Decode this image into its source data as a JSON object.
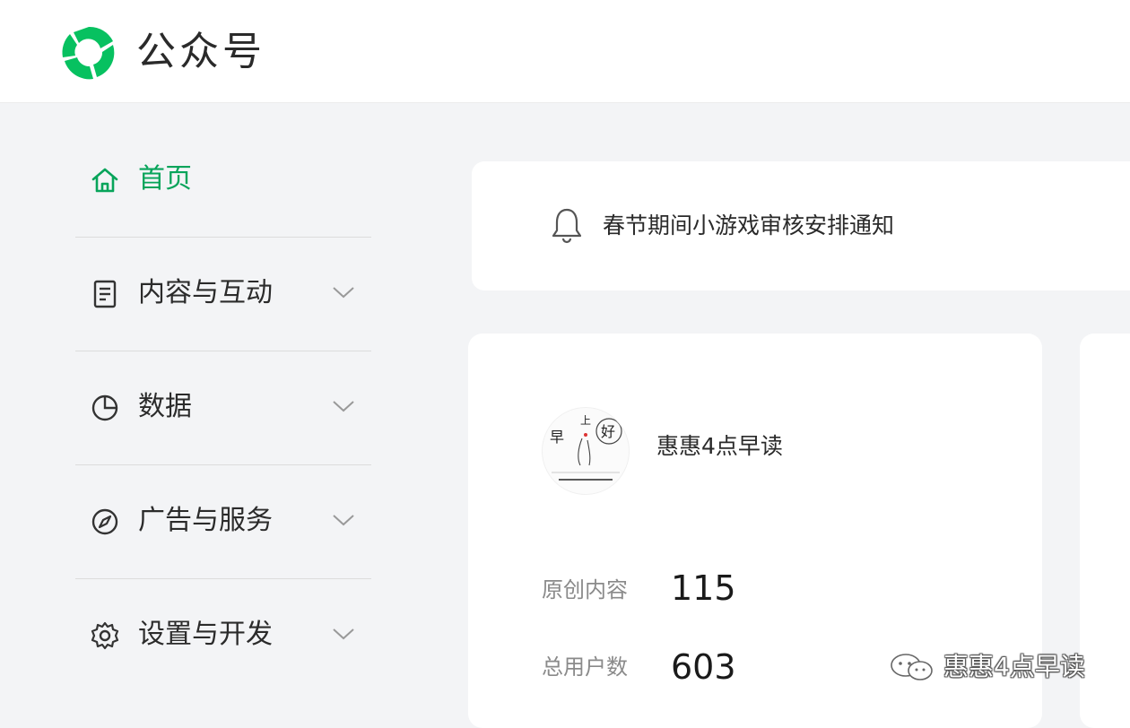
{
  "header": {
    "brand": "公众号"
  },
  "sidebar": {
    "items": [
      {
        "label": "首页",
        "icon": "home-icon",
        "active": true
      },
      {
        "label": "内容与互动",
        "icon": "document-icon"
      },
      {
        "label": "数据",
        "icon": "pie-chart-icon"
      },
      {
        "label": "广告与服务",
        "icon": "compass-icon"
      },
      {
        "label": "设置与开发",
        "icon": "gear-icon"
      }
    ]
  },
  "notice": {
    "text": "春节期间小游戏审核安排通知",
    "icon": "bell-icon"
  },
  "account": {
    "name": "惠惠4点早读",
    "avatar_text": {
      "a": "早",
      "b": "上",
      "c": "好"
    },
    "stats": [
      {
        "label": "原创内容",
        "value": "115"
      },
      {
        "label": "总用户数",
        "value": "603"
      }
    ]
  },
  "watermark": {
    "text": "惠惠4点早读"
  },
  "colors": {
    "accent": "#07a45a",
    "background": "#f3f4f6"
  }
}
